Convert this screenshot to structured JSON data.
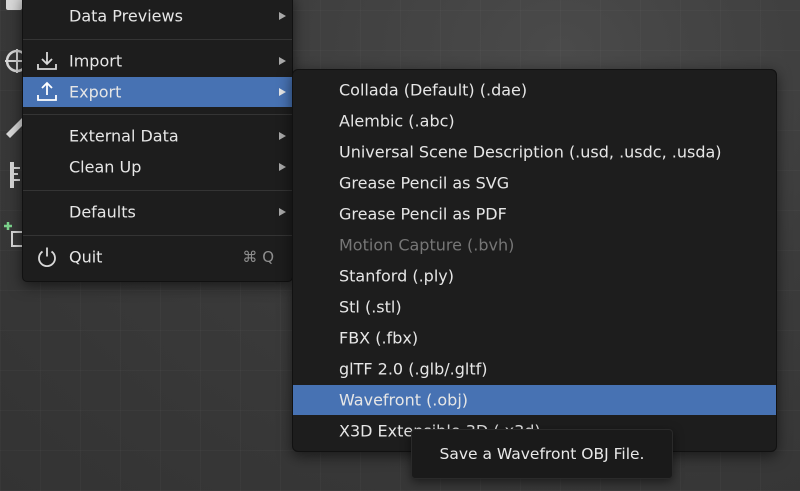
{
  "file_menu": {
    "items": [
      {
        "label": "Data Previews",
        "icon": "none",
        "submenu": true
      },
      {
        "label": "Import",
        "icon": "import-icon",
        "submenu": true
      },
      {
        "label": "Export",
        "icon": "export-icon",
        "submenu": true,
        "highlighted": true
      },
      {
        "label": "External Data",
        "icon": "none",
        "submenu": true
      },
      {
        "label": "Clean Up",
        "icon": "none",
        "submenu": true
      },
      {
        "label": "Defaults",
        "icon": "none",
        "submenu": true
      },
      {
        "label": "Quit",
        "icon": "power-icon",
        "shortcut": "⌘ Q"
      }
    ]
  },
  "export_menu": {
    "items": [
      {
        "label": "Collada (Default) (.dae)"
      },
      {
        "label": "Alembic (.abc)"
      },
      {
        "label": "Universal Scene Description (.usd, .usdc, .usda)"
      },
      {
        "label": "Grease Pencil as SVG"
      },
      {
        "label": "Grease Pencil as PDF"
      },
      {
        "label": "Motion Capture (.bvh)",
        "disabled": true
      },
      {
        "label": "Stanford (.ply)"
      },
      {
        "label": "Stl (.stl)"
      },
      {
        "label": "FBX (.fbx)"
      },
      {
        "label": "glTF 2.0 (.glb/.gltf)"
      },
      {
        "label": "Wavefront (.obj)",
        "highlighted": true
      },
      {
        "label": "X3D Extensible 3D (.x3d)"
      }
    ]
  },
  "tooltip": {
    "text": "Save a Wavefront OBJ File."
  },
  "colors": {
    "menu_bg": "#1d1d1d",
    "highlight": "#4772b3",
    "text": "#e6e6e6",
    "disabled_text": "#767676"
  }
}
